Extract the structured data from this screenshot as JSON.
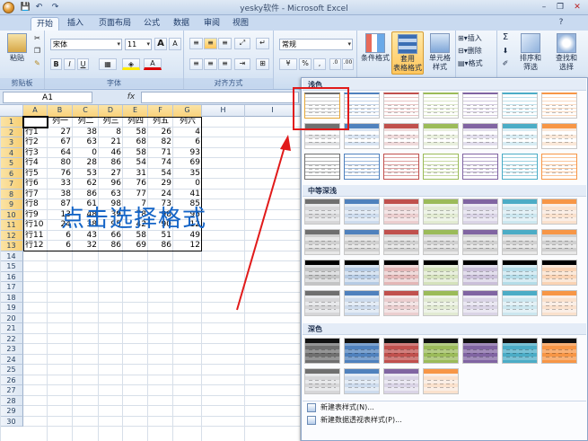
{
  "window": {
    "title": "yesky软件 - Microsoft Excel",
    "minimize": "–",
    "restore": "❐",
    "close": "✕",
    "help": "?"
  },
  "qat": [
    "💾",
    "↶",
    "↷"
  ],
  "tabs": [
    {
      "label": "开始",
      "active": true
    },
    {
      "label": "插入"
    },
    {
      "label": "页面布局"
    },
    {
      "label": "公式"
    },
    {
      "label": "数据"
    },
    {
      "label": "审阅"
    },
    {
      "label": "视图"
    }
  ],
  "ribbon": {
    "clipboard": {
      "label": "剪贴板",
      "paste": "粘贴"
    },
    "font": {
      "label": "字体",
      "name": "宋体",
      "size": "11",
      "bold": "B",
      "italic": "I",
      "underline": "U",
      "grow": "A",
      "shrink": "A"
    },
    "align": {
      "label": "对齐方式"
    },
    "number": {
      "format": "常规",
      "pct": "%",
      "comma": ","
    },
    "styles": {
      "cond": "条件格式",
      "table_line1": "套用",
      "table_line2": "表格格式",
      "cell_line1": "单元格",
      "cell_line2": "样式"
    },
    "cells": {
      "insert": "插入",
      "delete": "删除",
      "format": "格式"
    },
    "editing": {
      "sigma": "Σ",
      "sort_line1": "排序和",
      "sort_line2": "筛选",
      "find_line1": "查找和",
      "find_line2": "选择"
    }
  },
  "formula_bar": {
    "name_box": "A1",
    "fx": "fx"
  },
  "sheet": {
    "columns": [
      "A",
      "B",
      "C",
      "D",
      "E",
      "F",
      "G",
      "H",
      "I"
    ],
    "header_row": [
      "",
      "列一",
      "列二",
      "列三",
      "列四",
      "列五",
      "列六"
    ],
    "rows": [
      [
        "行1",
        "27",
        "38",
        "8",
        "58",
        "26",
        "4"
      ],
      [
        "行2",
        "67",
        "63",
        "21",
        "68",
        "82",
        "6"
      ],
      [
        "行3",
        "64",
        "0",
        "46",
        "58",
        "71",
        "93"
      ],
      [
        "行4",
        "80",
        "28",
        "86",
        "54",
        "74",
        "69"
      ],
      [
        "行5",
        "76",
        "53",
        "27",
        "31",
        "54",
        "35"
      ],
      [
        "行6",
        "33",
        "62",
        "96",
        "76",
        "29",
        "0"
      ],
      [
        "行7",
        "38",
        "86",
        "63",
        "77",
        "24",
        "41"
      ],
      [
        "行8",
        "87",
        "61",
        "98",
        "7",
        "73",
        "85"
      ],
      [
        "行9",
        "13",
        "48",
        "39",
        "78",
        "98",
        "95"
      ],
      [
        "行10",
        "24",
        "38",
        "95",
        "42",
        "90",
        "12"
      ],
      [
        "行11",
        "6",
        "43",
        "66",
        "58",
        "51",
        "49"
      ],
      [
        "行12",
        "6",
        "32",
        "86",
        "69",
        "86",
        "12"
      ]
    ],
    "row_numbers": [
      "1",
      "2",
      "3",
      "4",
      "5",
      "6",
      "7",
      "8",
      "9",
      "10",
      "11",
      "12",
      "13",
      "14",
      "15",
      "16",
      "17",
      "18",
      "19",
      "20",
      "21",
      "22",
      "23",
      "24",
      "25",
      "26",
      "27",
      "28",
      "29",
      "30"
    ]
  },
  "annotation": {
    "text": "点击选择格式",
    "color": "#1565c7",
    "arrow_color": "#e11a1a"
  },
  "gallery": {
    "light_label": "浅色",
    "medium_label": "中等深浅",
    "dark_label": "深色",
    "new_table_style": "新建表样式(N)...",
    "new_pivot_style": "新建数据透视表样式(P)...",
    "palette": [
      "#6f6f6f",
      "#4f81bd",
      "#c0504d",
      "#9bbb59",
      "#8064a2",
      "#4bacc6",
      "#f79646"
    ]
  }
}
